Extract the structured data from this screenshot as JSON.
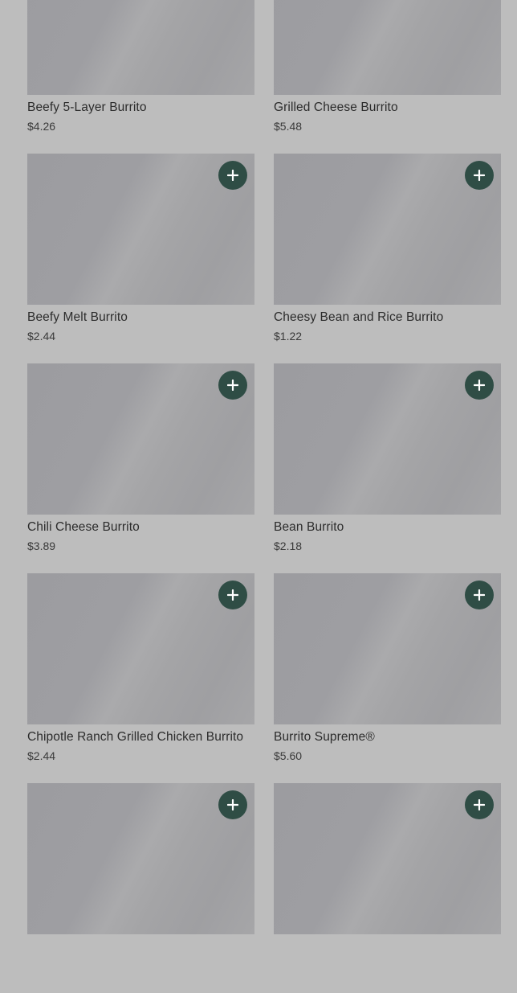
{
  "colors": {
    "overlay_background": "#bdbdbd",
    "add_button": "#2f4d45",
    "add_icon": "#ffffff"
  },
  "add_button_icon": "plus-icon",
  "products": [
    {
      "name": "Beefy 5-Layer Burrito",
      "price": "$4.26",
      "show_add": false
    },
    {
      "name": "Grilled Cheese Burrito",
      "price": "$5.48",
      "show_add": false
    },
    {
      "name": "Beefy Melt Burrito",
      "price": "$2.44",
      "show_add": true
    },
    {
      "name": "Cheesy Bean and Rice Burrito",
      "price": "$1.22",
      "show_add": true
    },
    {
      "name": "Chili Cheese Burrito",
      "price": "$3.89",
      "show_add": true
    },
    {
      "name": "Bean Burrito",
      "price": "$2.18",
      "show_add": true
    },
    {
      "name": "Chipotle Ranch Grilled Chicken Burrito",
      "price": "$2.44",
      "show_add": true
    },
    {
      "name": "Burrito Supreme®",
      "price": "$5.60",
      "show_add": true
    },
    {
      "name": "",
      "price": "",
      "show_add": true
    },
    {
      "name": "",
      "price": "",
      "show_add": true
    }
  ]
}
